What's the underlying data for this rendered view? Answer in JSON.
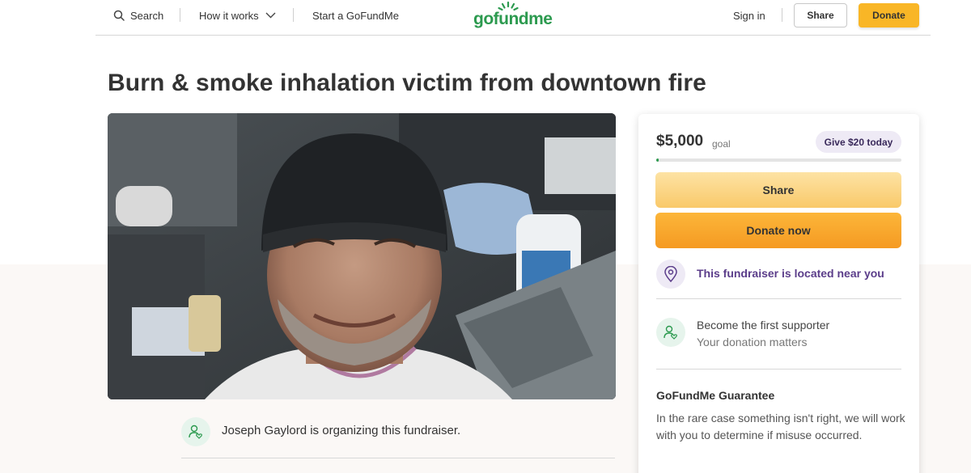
{
  "header": {
    "search_label": "Search",
    "how_it_works_label": "How it works",
    "start_label": "Start a GoFundMe",
    "logo_text": "gofundme",
    "sign_in_label": "Sign in",
    "share_label": "Share",
    "donate_label": "Donate"
  },
  "campaign": {
    "title": "Burn & smoke inhalation victim from downtown fire",
    "organizer_text": "Joseph Gaylord is organizing this fundraiser."
  },
  "sidebar": {
    "goal_amount": "$5,000",
    "goal_label": "goal",
    "give_pill": "Give $20 today",
    "progress_fraction": 0.01,
    "share_button": "Share",
    "donate_button": "Donate now",
    "location_text": "This fundraiser is located near you",
    "supporter_title": "Become the first supporter",
    "supporter_sub": "Your donation matters",
    "guarantee_title": "GoFundMe Guarantee",
    "guarantee_body": "In the rare case something isn't right, we will work with you to determine if misuse occurred."
  },
  "colors": {
    "brand_green": "#2c9a4f",
    "donate_orange": "#f9b626",
    "location_purple": "#5b3d8a"
  },
  "icons": {
    "search": "search-icon",
    "chevron": "chevron-down-icon",
    "location": "location-pin-icon",
    "supporter": "person-heart-icon"
  }
}
